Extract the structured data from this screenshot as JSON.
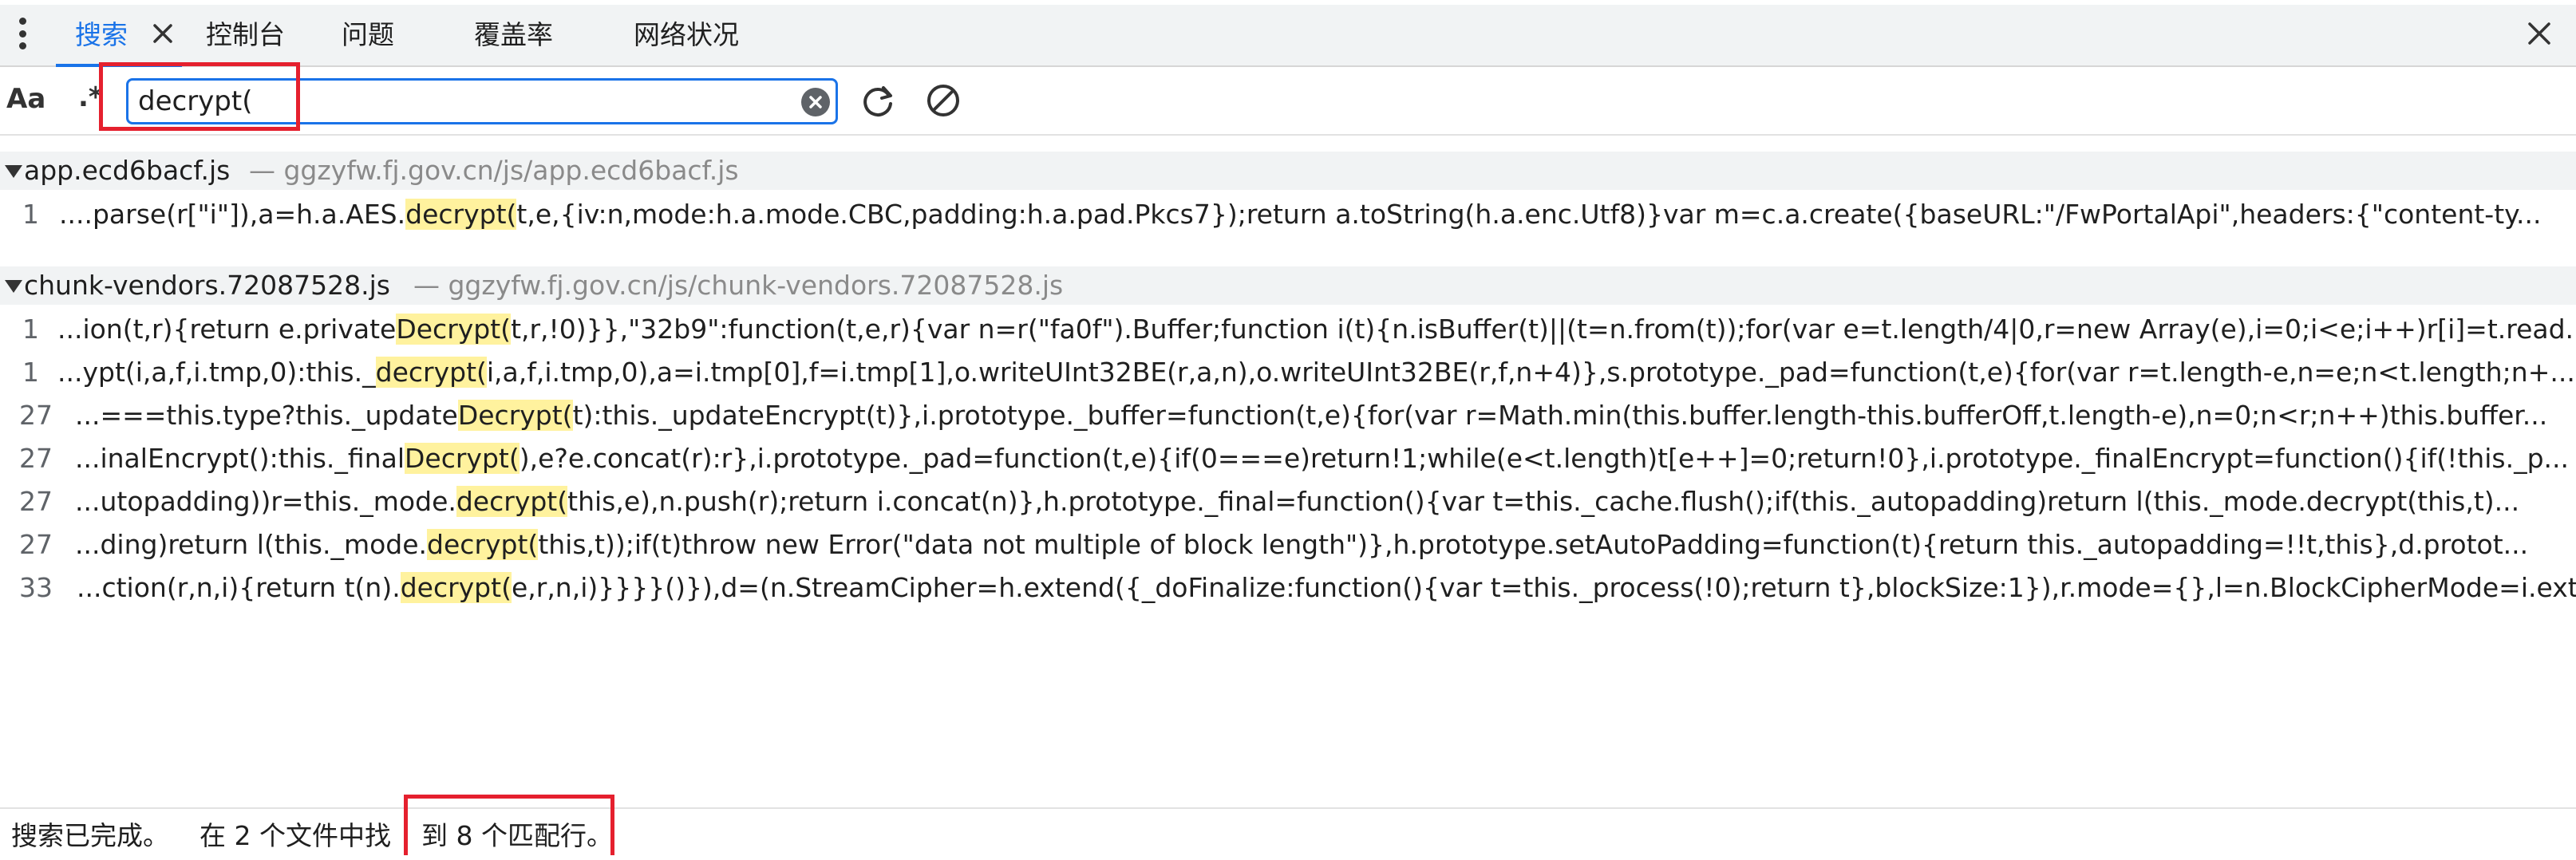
{
  "tabs": [
    {
      "label": "搜索",
      "active": true
    },
    {
      "label": "控制台"
    },
    {
      "label": "问题"
    },
    {
      "label": "覆盖率"
    },
    {
      "label": "网络状况"
    }
  ],
  "icons": {
    "menu": "kebab-menu-icon",
    "tab_close": "close-icon",
    "window_close": "close-icon",
    "clear": "clear-input-icon",
    "refresh": "refresh-icon",
    "cancel": "cancel-icon"
  },
  "toolbar": {
    "match_case_label": "Aa",
    "regex_label": ".*",
    "search_value": "decrypt("
  },
  "colors": {
    "accent": "#1a73e8",
    "highlight": "#fff29e",
    "annotation_red": "#e5202e"
  },
  "results": [
    {
      "file": "app.ecd6bacf.js",
      "path": "— ggzyfw.fj.gov.cn/js/app.ecd6bacf.js",
      "matches": [
        {
          "line": "1",
          "pre": "....parse(r[\"i\"]),a=h.a.AES.",
          "hl": "decrypt(",
          "post": "t,e,{iv:n,mode:h.a.mode.CBC,padding:h.a.pad.Pkcs7});return a.toString(h.a.enc.Utf8)}var m=c.a.create({baseURL:\"/FwPortalApi\",headers:{\"content-ty..."
        }
      ]
    },
    {
      "file": "chunk-vendors.72087528.js",
      "path": "— ggzyfw.fj.gov.cn/js/chunk-vendors.72087528.js",
      "matches": [
        {
          "line": "1",
          "pre": "...ion(t,r){return e.private",
          "hl": "Decrypt(",
          "post": "t,r,!0)}},\"32b9\":function(t,e,r){var n=r(\"fa0f\").Buffer;function i(t){n.isBuffer(t)||(t=n.from(t));for(var e=t.length/4|0,r=new Array(e),i=0;i<e;i++)r[i]=t.read..."
        },
        {
          "line": "1",
          "pre": "...ypt(i,a,f,i.tmp,0):this._",
          "hl": "decrypt(",
          "post": "i,a,f,i.tmp,0),a=i.tmp[0],f=i.tmp[1],o.writeUInt32BE(r,a,n),o.writeUInt32BE(r,f,n+4)},s.prototype._pad=function(t,e){for(var r=t.length-e,n=e;n<t.length;n+..."
        },
        {
          "line": "27",
          "pre": "...===this.type?this._update",
          "hl": "Decrypt(",
          "post": "t):this._updateEncrypt(t)},i.prototype._buffer=function(t,e){for(var r=Math.min(this.buffer.length-this.bufferOff,t.length-e),n=0;n<r;n++)this.buffer..."
        },
        {
          "line": "27",
          "pre": "...inalEncrypt():this._final",
          "hl": "Decrypt(",
          "post": "),e?e.concat(r):r},i.prototype._pad=function(t,e){if(0===e)return!1;while(e<t.length)t[e++]=0;return!0},i.prototype._finalEncrypt=function(){if(!this._p..."
        },
        {
          "line": "27",
          "pre": "...utopadding))r=this._mode.",
          "hl": "decrypt(",
          "post": "this,e),n.push(r);return i.concat(n)},h.prototype._final=function(){var t=this._cache.flush();if(this._autopadding)return l(this._mode.decrypt(this,t)..."
        },
        {
          "line": "27",
          "pre": "...ding)return l(this._mode.",
          "hl": "decrypt(",
          "post": "this,t));if(t)throw new Error(\"data not multiple of block length\")},h.prototype.setAutoPadding=function(t){return this._autopadding=!!t,this},d.protot..."
        },
        {
          "line": "33",
          "pre": "...ction(r,n,i){return t(n).",
          "hl": "decrypt(",
          "post": "e,r,n,i)}}}}()}),d=(n.StreamCipher=h.extend({_doFinalize:function(){var t=this._process(!0);return t},blockSize:1}),r.mode={},l=n.BlockCipherMode=i.ext..."
        }
      ]
    }
  ],
  "status": {
    "done": "搜索已完成。",
    "summary_a": "在 2 个文件中找",
    "summary_b": "到 8 个匹配行。"
  }
}
